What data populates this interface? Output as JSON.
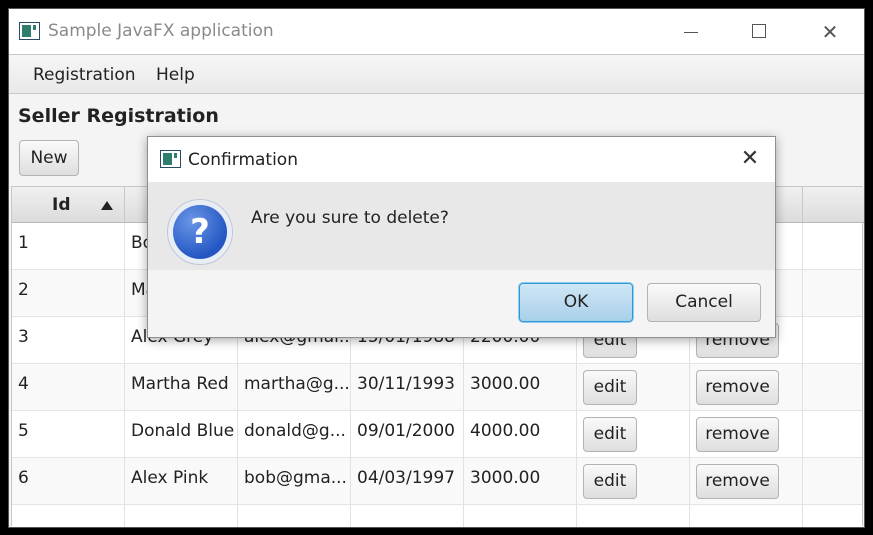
{
  "window": {
    "title": "Sample JavaFX application"
  },
  "controls": {
    "minimize": "minimize",
    "maximize": "maximize",
    "close": "✕"
  },
  "menu": [
    "Registration",
    "Help"
  ],
  "page": {
    "title": "Seller Registration",
    "new_button": "New"
  },
  "table": {
    "columns": [
      "Id",
      "",
      "",
      "",
      "",
      "",
      "",
      ""
    ],
    "sort_column": "Id",
    "rows": [
      {
        "id": "1",
        "name": "Bo",
        "email": "",
        "birth": "",
        "salary": "",
        "edit": "",
        "remove": ""
      },
      {
        "id": "2",
        "name": "Ma",
        "email": "",
        "birth": "",
        "salary": "",
        "edit": "",
        "remove": ""
      },
      {
        "id": "3",
        "name": "Alex Grey",
        "email": "alex@gmai...",
        "birth": "15/01/1988",
        "salary": "2200.00",
        "edit": "edit",
        "remove": "remove"
      },
      {
        "id": "4",
        "name": "Martha Red",
        "email": "martha@g...",
        "birth": "30/11/1993",
        "salary": "3000.00",
        "edit": "edit",
        "remove": "remove"
      },
      {
        "id": "5",
        "name": "Donald Blue",
        "email": "donald@g...",
        "birth": "09/01/2000",
        "salary": "4000.00",
        "edit": "edit",
        "remove": "remove"
      },
      {
        "id": "6",
        "name": "Alex Pink",
        "email": "bob@gma...",
        "birth": "04/03/1997",
        "salary": "3000.00",
        "edit": "edit",
        "remove": "remove"
      }
    ]
  },
  "dialog": {
    "title": "Confirmation",
    "close": "✕",
    "message": "Are you sure to delete?",
    "ok": "OK",
    "cancel": "Cancel"
  }
}
